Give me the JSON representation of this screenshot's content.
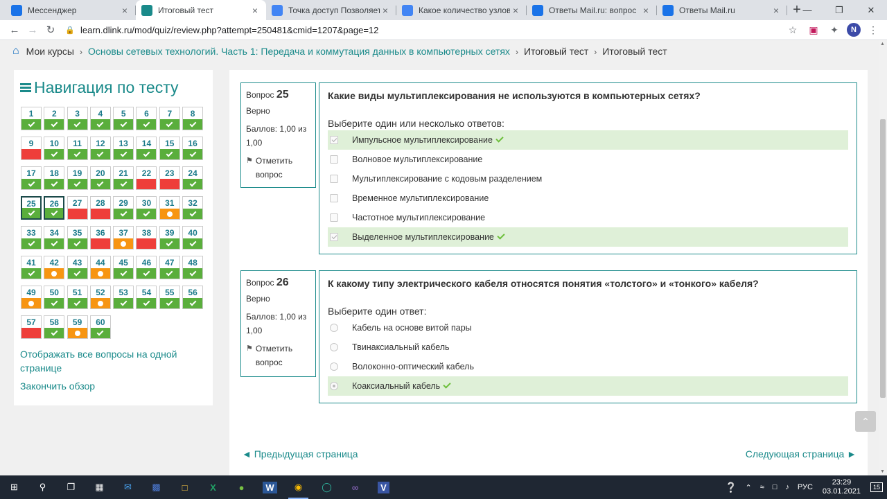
{
  "browser": {
    "tabs": [
      {
        "title": "Мессенджер",
        "icon_color": "#1a73e8",
        "active": false
      },
      {
        "title": "Итоговый тест",
        "icon_color": "#1a8a8a",
        "active": true
      },
      {
        "title": "Точка доступ Позволяет об",
        "icon_color": "#4285f4",
        "active": false
      },
      {
        "title": "Какое количество узлов до",
        "icon_color": "#4285f4",
        "active": false
      },
      {
        "title": "Ответы Mail.ru: вопрос",
        "icon_color": "#1a73e8",
        "active": false
      },
      {
        "title": "Ответы Mail.ru",
        "icon_color": "#1a73e8",
        "active": false
      }
    ],
    "url": "learn.dlink.ru/mod/quiz/review.php?attempt=250481&cmid=1207&page=12",
    "profile_initial": "N"
  },
  "breadcrumb": {
    "items": [
      {
        "label": "Мои курсы",
        "link": false
      },
      {
        "label": "Основы сетевых технологий. Часть 1: Передача и коммутация данных в компьютерных сетях",
        "link": true
      },
      {
        "label": "Итоговый тест",
        "link": false
      },
      {
        "label": "Итоговый тест",
        "link": false
      }
    ]
  },
  "quiznav": {
    "title": "Навигация по тесту",
    "questions": [
      {
        "n": "1",
        "s": "correct"
      },
      {
        "n": "2",
        "s": "correct"
      },
      {
        "n": "3",
        "s": "correct"
      },
      {
        "n": "4",
        "s": "correct"
      },
      {
        "n": "5",
        "s": "correct"
      },
      {
        "n": "6",
        "s": "correct"
      },
      {
        "n": "7",
        "s": "correct"
      },
      {
        "n": "8",
        "s": "correct"
      },
      {
        "n": "9",
        "s": "wrong"
      },
      {
        "n": "10",
        "s": "correct"
      },
      {
        "n": "11",
        "s": "correct"
      },
      {
        "n": "12",
        "s": "correct"
      },
      {
        "n": "13",
        "s": "correct"
      },
      {
        "n": "14",
        "s": "correct"
      },
      {
        "n": "15",
        "s": "correct"
      },
      {
        "n": "16",
        "s": "correct"
      },
      {
        "n": "17",
        "s": "correct"
      },
      {
        "n": "18",
        "s": "correct"
      },
      {
        "n": "19",
        "s": "correct"
      },
      {
        "n": "20",
        "s": "correct"
      },
      {
        "n": "21",
        "s": "correct"
      },
      {
        "n": "22",
        "s": "wrong"
      },
      {
        "n": "23",
        "s": "wrong"
      },
      {
        "n": "24",
        "s": "correct"
      },
      {
        "n": "25",
        "s": "correct",
        "current": true
      },
      {
        "n": "26",
        "s": "correct",
        "current": true
      },
      {
        "n": "27",
        "s": "wrong"
      },
      {
        "n": "28",
        "s": "wrong"
      },
      {
        "n": "29",
        "s": "correct"
      },
      {
        "n": "30",
        "s": "correct"
      },
      {
        "n": "31",
        "s": "partial"
      },
      {
        "n": "32",
        "s": "correct"
      },
      {
        "n": "33",
        "s": "correct"
      },
      {
        "n": "34",
        "s": "correct"
      },
      {
        "n": "35",
        "s": "correct"
      },
      {
        "n": "36",
        "s": "wrong"
      },
      {
        "n": "37",
        "s": "partial"
      },
      {
        "n": "38",
        "s": "wrong"
      },
      {
        "n": "39",
        "s": "correct"
      },
      {
        "n": "40",
        "s": "correct"
      },
      {
        "n": "41",
        "s": "correct"
      },
      {
        "n": "42",
        "s": "partial"
      },
      {
        "n": "43",
        "s": "correct"
      },
      {
        "n": "44",
        "s": "partial"
      },
      {
        "n": "45",
        "s": "correct"
      },
      {
        "n": "46",
        "s": "correct"
      },
      {
        "n": "47",
        "s": "correct"
      },
      {
        "n": "48",
        "s": "correct"
      },
      {
        "n": "49",
        "s": "partial"
      },
      {
        "n": "50",
        "s": "correct"
      },
      {
        "n": "51",
        "s": "correct"
      },
      {
        "n": "52",
        "s": "partial"
      },
      {
        "n": "53",
        "s": "correct"
      },
      {
        "n": "54",
        "s": "correct"
      },
      {
        "n": "55",
        "s": "correct"
      },
      {
        "n": "56",
        "s": "correct"
      },
      {
        "n": "57",
        "s": "wrong"
      },
      {
        "n": "58",
        "s": "correct"
      },
      {
        "n": "59",
        "s": "partial"
      },
      {
        "n": "60",
        "s": "correct"
      }
    ],
    "show_all_link": "Отображать все вопросы на одной странице",
    "finish_link": "Закончить обзор"
  },
  "questions": [
    {
      "label": "Вопрос",
      "number": "25",
      "state": "Верно",
      "grade": "Баллов: 1,00 из 1,00",
      "flag": "Отметить вопрос",
      "text": "Какие виды мультиплексирования не используются в компьютерных сетях?",
      "prompt": "Выберите один или несколько ответов:",
      "type": "checkbox",
      "answers": [
        {
          "label": "Импульсное мультиплексирование",
          "checked": true,
          "correct": true
        },
        {
          "label": "Волновое мультиплексирование",
          "checked": false,
          "correct": false
        },
        {
          "label": "Мультиплексирование с кодовым разделением",
          "checked": false,
          "correct": false
        },
        {
          "label": "Временное мультиплексирование",
          "checked": false,
          "correct": false
        },
        {
          "label": "Частотное мультиплексирование",
          "checked": false,
          "correct": false
        },
        {
          "label": "Выделенное мультиплексирование",
          "checked": true,
          "correct": true
        }
      ]
    },
    {
      "label": "Вопрос",
      "number": "26",
      "state": "Верно",
      "grade": "Баллов: 1,00 из 1,00",
      "flag": "Отметить вопрос",
      "text": "К какому типу электрического кабеля относятся понятия «толстого» и «тонкого» кабеля?",
      "prompt": "Выберите один ответ:",
      "type": "radio",
      "answers": [
        {
          "label": "Кабель на основе витой пары",
          "checked": false,
          "correct": false
        },
        {
          "label": "Твинаксиальный кабель",
          "checked": false,
          "correct": false
        },
        {
          "label": "Волоконно-оптический кабель",
          "checked": false,
          "correct": false
        },
        {
          "label": "Коаксиальный кабель",
          "checked": true,
          "correct": true
        }
      ]
    }
  ],
  "pager": {
    "prev": "◄ Предыдущая страница",
    "next": "Следующая страница ►"
  },
  "taskbar": {
    "lang": "РУС",
    "time": "23:29",
    "date": "03.01.2021",
    "notifications": "15"
  },
  "colors": {
    "accent": "#1a8a8a",
    "correct": "#5aae3c",
    "wrong": "#ee3e3a",
    "partial": "#f79512"
  }
}
